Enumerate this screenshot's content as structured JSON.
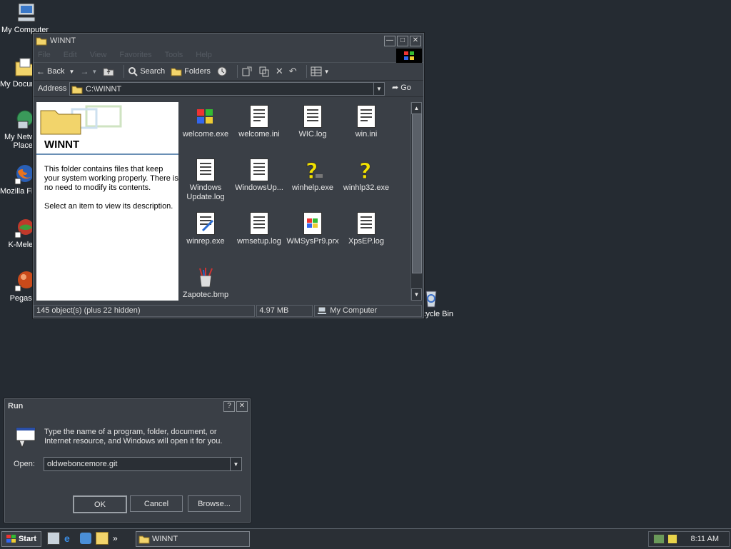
{
  "desktop": {
    "icons": [
      {
        "label": "My Computer",
        "name": "my-computer"
      },
      {
        "label": "My Documents",
        "name": "my-documents"
      },
      {
        "label": "My Network Places",
        "name": "my-network-places"
      },
      {
        "label": "Mozilla Firefox",
        "name": "mozilla-firefox"
      },
      {
        "label": "K-Meleon",
        "name": "k-meleon"
      },
      {
        "label": "Pegasus",
        "name": "pegasus"
      },
      {
        "label": "Recycle Bin",
        "name": "recycle-bin"
      }
    ]
  },
  "explorer": {
    "title": "WINNT",
    "menu": [
      "File",
      "Edit",
      "View",
      "Favorites",
      "Tools",
      "Help"
    ],
    "toolbar": {
      "back": "Back",
      "search": "Search",
      "folders": "Folders"
    },
    "address_label": "Address",
    "address_value": "C:\\WINNT",
    "go_label": "Go",
    "side": {
      "title": "WINNT",
      "desc": "This folder contains files that keep your system working properly. There is no need to modify its contents.",
      "hint": "Select an item to view its description."
    },
    "files": [
      {
        "label": "welcome.exe",
        "icon": "windows-flag-icon"
      },
      {
        "label": "welcome.ini",
        "icon": "ini-file-icon"
      },
      {
        "label": "WIC.log",
        "icon": "text-file-icon"
      },
      {
        "label": "win.ini",
        "icon": "ini-file-icon"
      },
      {
        "label": "Windows Update.log",
        "icon": "text-file-icon"
      },
      {
        "label": "WindowsUp...",
        "icon": "text-file-icon"
      },
      {
        "label": "winhelp.exe",
        "icon": "help-icon"
      },
      {
        "label": "winhlp32.exe",
        "icon": "help-icon"
      },
      {
        "label": "winrep.exe",
        "icon": "report-icon"
      },
      {
        "label": "wmsetup.log",
        "icon": "text-file-icon"
      },
      {
        "label": "WMSysPr9.prx",
        "icon": "media-file-icon"
      },
      {
        "label": "XpsEP.log",
        "icon": "text-file-icon"
      },
      {
        "label": "Zapotec.bmp",
        "icon": "paint-icon"
      }
    ],
    "status": {
      "objects": "145 object(s) (plus 22 hidden)",
      "size": "4.97 MB",
      "location": "My Computer"
    }
  },
  "run": {
    "title": "Run",
    "desc": "Type the name of a program, folder, document, or Internet resource, and Windows will open it for you.",
    "open_label": "Open:",
    "open_value": "oldweboncemore.git",
    "ok": "OK",
    "cancel": "Cancel",
    "browse": "Browse..."
  },
  "taskbar": {
    "start": "Start",
    "task": "WINNT",
    "clock": "8:11 AM",
    "overflow": "»"
  }
}
